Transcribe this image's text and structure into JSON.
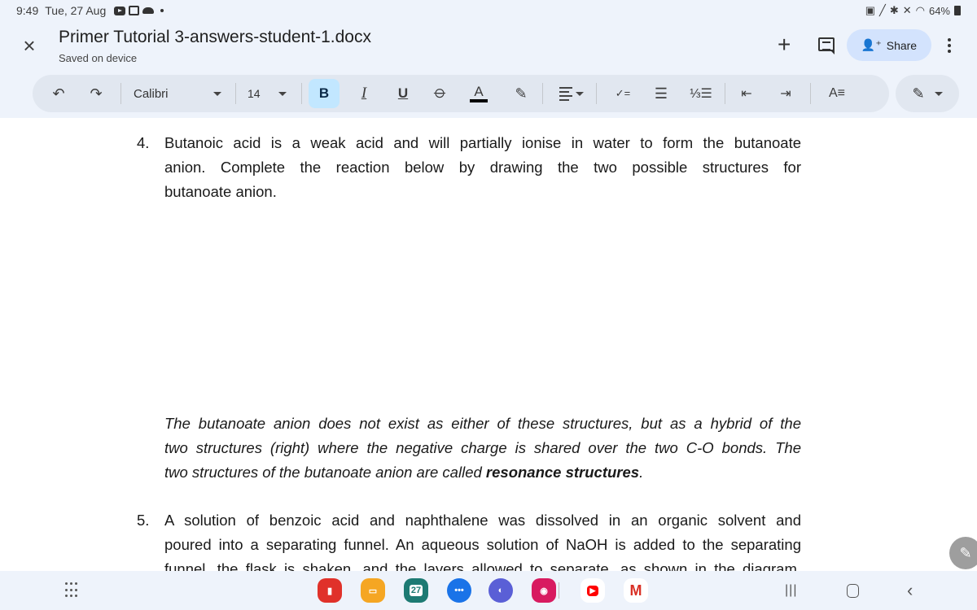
{
  "status_bar": {
    "time": "9:49",
    "date": "Tue, 27 Aug",
    "notification_icons": [
      "youtube-icon",
      "gallery-icon",
      "cloud-icon",
      "dot-icon"
    ],
    "system_icons": [
      "battery-saver-icon",
      "pen-icon",
      "bluetooth-icon",
      "mute-icon",
      "wifi-icon"
    ],
    "battery": "64%"
  },
  "header": {
    "title": "Primer Tutorial 3-answers-student-1.docx",
    "subtitle": "Saved on device",
    "share_label": "Share"
  },
  "toolbar": {
    "font": "Calibri",
    "font_size": "14",
    "bold": "B",
    "italic": "I",
    "underline": "U",
    "strikethrough": "S",
    "text_color": "A",
    "text_color_value": "#000000",
    "format_text": "A≡",
    "bold_active": true
  },
  "document": {
    "q4": {
      "number": "4.",
      "lines": [
        "Butanoic acid is a weak acid and will partially ionise in water to form the butanoate",
        "anion. Complete the reaction below by drawing the two possible structures for",
        "butanoate anion."
      ]
    },
    "note": {
      "lines": [
        "The butanoate anion does not exist as either of these structures, but as a hybrid of the",
        "two structures (right) where the negative charge is shared over the two C-O bonds. The"
      ],
      "last_prefix": "two structures of the butanoate anion are called ",
      "last_bold": "resonance structures",
      "last_suffix": "."
    },
    "q5": {
      "number": "5.",
      "lines": [
        "A solution of benzoic acid and naphthalene was dissolved in an organic solvent and",
        "poured into a separating funnel. An aqueous solution of NaOH is added to the separating",
        "funnel, the flask is shaken, and the layers allowed to separate, as shown in the diagram."
      ]
    }
  },
  "dock": {
    "calendar_day": "27",
    "apps": [
      "notes",
      "files",
      "calendar",
      "messages",
      "internet",
      "camera",
      "youtube",
      "gmail"
    ]
  },
  "colors": {
    "accent": "#d3e3fd",
    "bold_active_bg": "#c2e7ff",
    "toolbar_bg": "#e1e7f0",
    "app_bg": "#eef3fb"
  }
}
